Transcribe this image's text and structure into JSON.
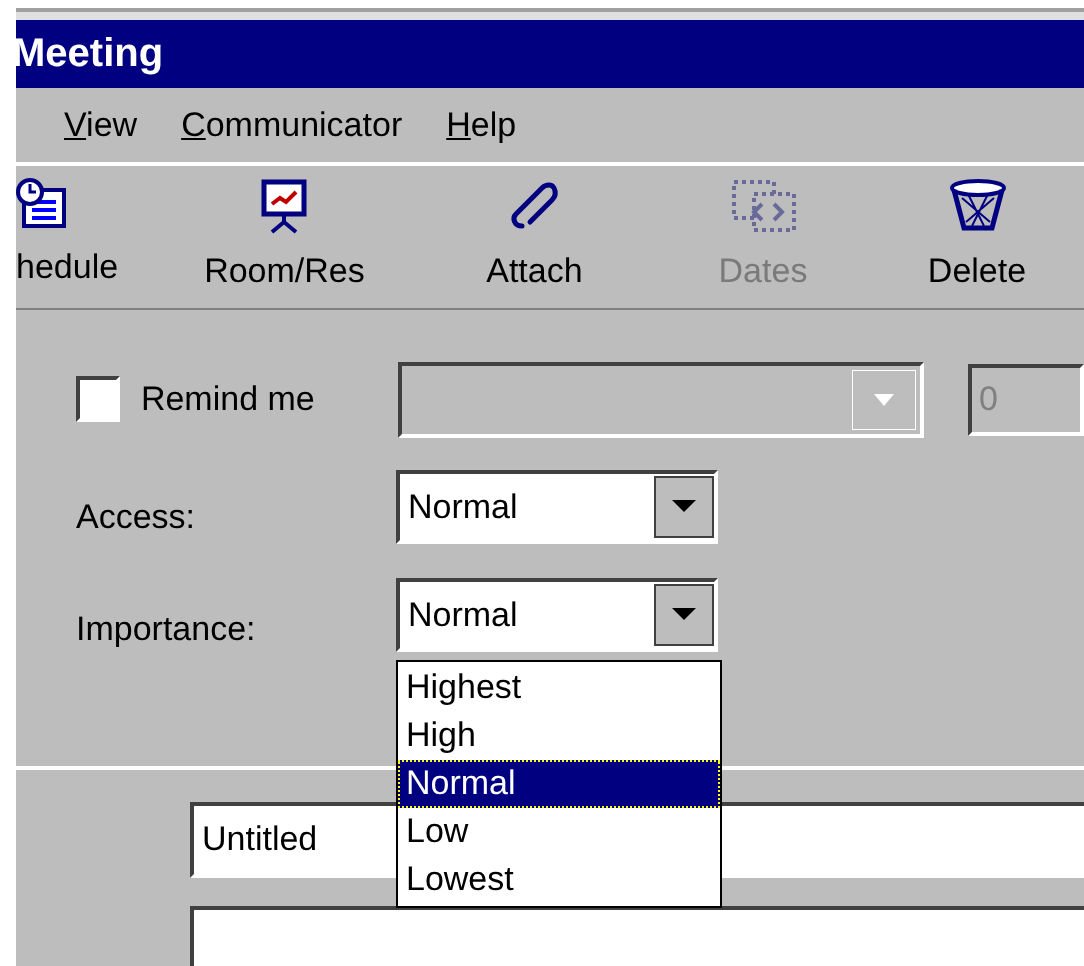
{
  "window": {
    "title": "Meeting"
  },
  "menu": [
    {
      "label": "View"
    },
    {
      "label": "Communicator"
    },
    {
      "label": "Help"
    }
  ],
  "toolbar": [
    {
      "label": "hedule",
      "kind": "schedule",
      "disabled": false
    },
    {
      "label": "Room/Res",
      "kind": "room",
      "disabled": false
    },
    {
      "label": "Attach",
      "kind": "attach",
      "disabled": false
    },
    {
      "label": "Dates",
      "kind": "dates",
      "disabled": true
    },
    {
      "label": "Delete",
      "kind": "delete",
      "disabled": false
    }
  ],
  "reminder": {
    "label": "Remind me",
    "checked": false,
    "count": "0"
  },
  "access": {
    "label": "Access:",
    "value": "Normal"
  },
  "importance": {
    "label": "Importance:",
    "value": "Normal",
    "expanded": true,
    "options": [
      {
        "label": "Highest",
        "selected": false
      },
      {
        "label": "High",
        "selected": false
      },
      {
        "label": "Normal",
        "selected": true
      },
      {
        "label": "Low",
        "selected": false
      },
      {
        "label": "Lowest",
        "selected": false
      }
    ]
  },
  "title_field": {
    "value": "Untitled"
  }
}
